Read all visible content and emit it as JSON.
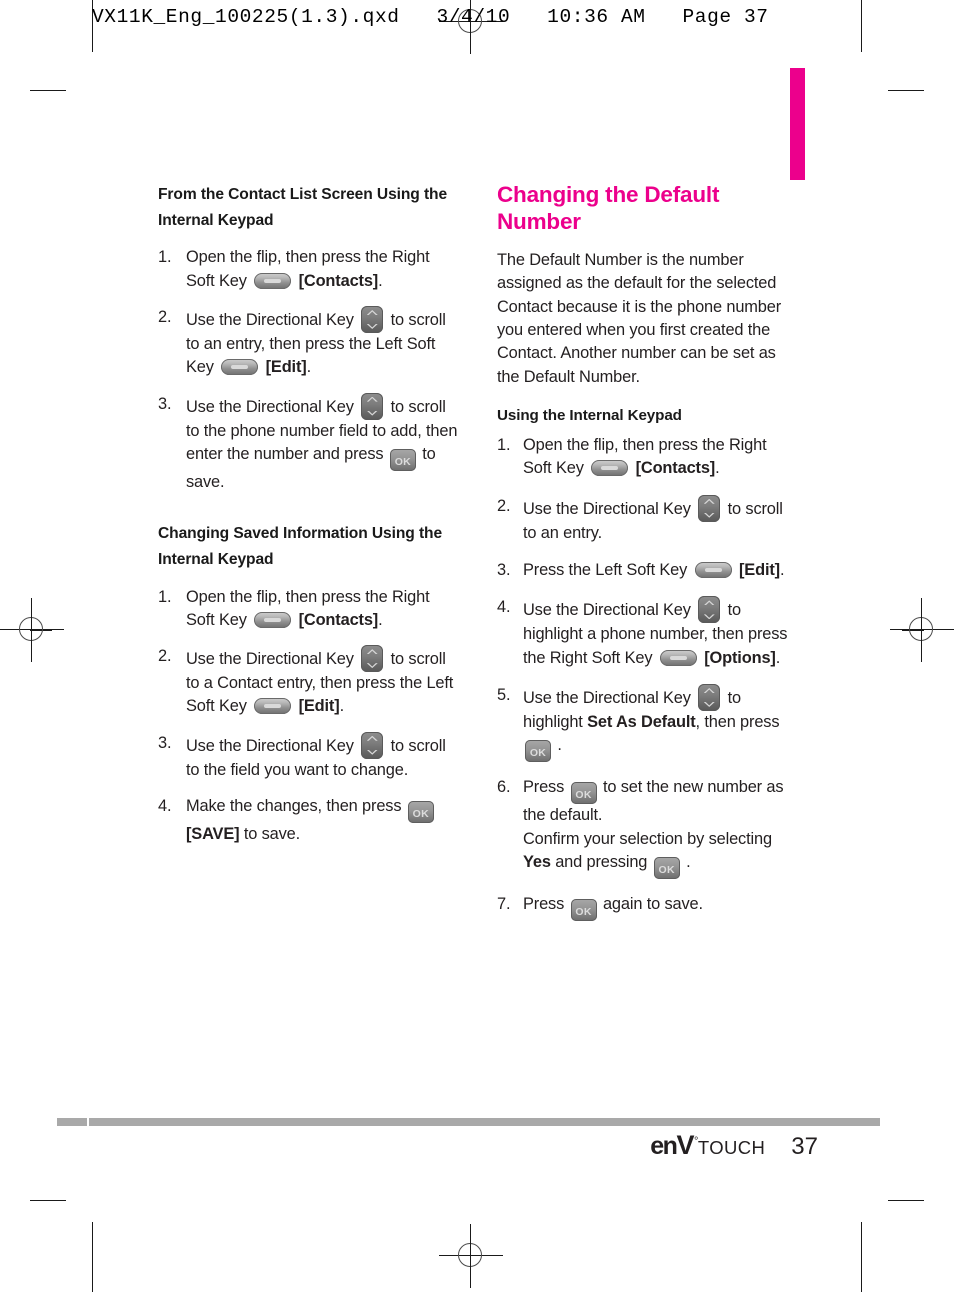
{
  "page": {
    "slug": "VX11K_Eng_100225(1.3).qxd   3/4/10   10:36 AM   Page 37",
    "accent_color": "#ec008c",
    "text_color": "#231f20"
  },
  "footer": {
    "brand_en": "en",
    "brand_v": "V",
    "brand_star": "°",
    "brand_touch": "TOUCH",
    "page_number": "37"
  },
  "icons": {
    "soft_key": "soft-key-icon",
    "directional_key": "directional-key-icon",
    "ok_key": "ok-key-icon",
    "ok_label": "OK"
  },
  "left_column": {
    "section1": {
      "title": "From the Contact List Screen Using the Internal Keypad",
      "steps": [
        {
          "num": "1.",
          "parts": [
            {
              "t": "text",
              "v": "Open the flip, then press the Right Soft Key "
            },
            {
              "t": "key",
              "v": "soft"
            },
            {
              "t": "bold",
              "v": " [Contacts]"
            },
            {
              "t": "text",
              "v": "."
            }
          ]
        },
        {
          "num": "2.",
          "parts": [
            {
              "t": "text",
              "v": "Use the Directional Key "
            },
            {
              "t": "key",
              "v": "dir"
            },
            {
              "t": "text",
              "v": " to scroll to an entry, then press the Left Soft Key "
            },
            {
              "t": "key",
              "v": "soft"
            },
            {
              "t": "bold",
              "v": " [Edit]"
            },
            {
              "t": "text",
              "v": "."
            }
          ]
        },
        {
          "num": "3.",
          "parts": [
            {
              "t": "text",
              "v": "Use the Directional Key "
            },
            {
              "t": "key",
              "v": "dir"
            },
            {
              "t": "text",
              "v": " to scroll to the phone number field to add, then enter the number and press "
            },
            {
              "t": "key",
              "v": "ok"
            },
            {
              "t": "text",
              "v": " to save."
            }
          ]
        }
      ]
    },
    "section2": {
      "title": "Changing Saved Information Using the Internal Keypad",
      "steps": [
        {
          "num": "1.",
          "parts": [
            {
              "t": "text",
              "v": "Open the flip, then press the Right Soft Key "
            },
            {
              "t": "key",
              "v": "soft"
            },
            {
              "t": "bold",
              "v": " [Contacts]"
            },
            {
              "t": "text",
              "v": "."
            }
          ]
        },
        {
          "num": "2.",
          "parts": [
            {
              "t": "text",
              "v": "Use the Directional Key "
            },
            {
              "t": "key",
              "v": "dir"
            },
            {
              "t": "text",
              "v": " to scroll to a Contact entry, then press the Left Soft Key "
            },
            {
              "t": "key",
              "v": "soft"
            },
            {
              "t": "bold",
              "v": " [Edit]"
            },
            {
              "t": "text",
              "v": "."
            }
          ]
        },
        {
          "num": "3.",
          "parts": [
            {
              "t": "text",
              "v": "Use the Directional Key "
            },
            {
              "t": "key",
              "v": "dir"
            },
            {
              "t": "text",
              "v": " to scroll to the field you want to change."
            }
          ]
        },
        {
          "num": "4.",
          "parts": [
            {
              "t": "text",
              "v": "Make the changes, then press "
            },
            {
              "t": "key",
              "v": "ok"
            },
            {
              "t": "bold",
              "v": " [SAVE]"
            },
            {
              "t": "text",
              "v": " to save."
            }
          ]
        }
      ]
    }
  },
  "right_column": {
    "chapter_title": "Changing the Default Number",
    "intro": "The Default Number is the number assigned as the default for the selected Contact because it is the phone number you entered when you first created the Contact. Another number can be set as the Default Number.",
    "section": {
      "title": "Using the Internal Keypad",
      "steps": [
        {
          "num": "1.",
          "parts": [
            {
              "t": "text",
              "v": "Open the flip, then press the Right Soft Key "
            },
            {
              "t": "key",
              "v": "soft"
            },
            {
              "t": "bold",
              "v": " [Contacts]"
            },
            {
              "t": "text",
              "v": "."
            }
          ]
        },
        {
          "num": "2.",
          "parts": [
            {
              "t": "text",
              "v": "Use the Directional Key "
            },
            {
              "t": "key",
              "v": "dir"
            },
            {
              "t": "text",
              "v": " to scroll to an entry."
            }
          ]
        },
        {
          "num": "3.",
          "parts": [
            {
              "t": "text",
              "v": "Press the Left Soft Key "
            },
            {
              "t": "key",
              "v": "soft"
            },
            {
              "t": "bold",
              "v": " [Edit]"
            },
            {
              "t": "text",
              "v": "."
            }
          ]
        },
        {
          "num": "4.",
          "parts": [
            {
              "t": "text",
              "v": "Use the Directional Key "
            },
            {
              "t": "key",
              "v": "dir"
            },
            {
              "t": "text",
              "v": " to highlight a phone number, then press the Right Soft Key "
            },
            {
              "t": "key",
              "v": "soft"
            },
            {
              "t": "bold",
              "v": " [Options]"
            },
            {
              "t": "text",
              "v": "."
            }
          ]
        },
        {
          "num": "5.",
          "parts": [
            {
              "t": "text",
              "v": "Use the Directional Key "
            },
            {
              "t": "key",
              "v": "dir"
            },
            {
              "t": "text",
              "v": " to highlight "
            },
            {
              "t": "bold",
              "v": "Set As Default"
            },
            {
              "t": "text",
              "v": ", then press "
            },
            {
              "t": "key",
              "v": "ok"
            },
            {
              "t": "text",
              "v": " ."
            }
          ]
        },
        {
          "num": "6.",
          "parts": [
            {
              "t": "text",
              "v": "Press "
            },
            {
              "t": "key",
              "v": "ok"
            },
            {
              "t": "text",
              "v": " to set the new number as the default."
            },
            {
              "t": "break",
              "v": ""
            },
            {
              "t": "text",
              "v": "Confirm your selection by selecting "
            },
            {
              "t": "bold",
              "v": "Yes"
            },
            {
              "t": "text",
              "v": " and pressing "
            },
            {
              "t": "key",
              "v": "ok"
            },
            {
              "t": "text",
              "v": " ."
            }
          ]
        },
        {
          "num": "7.",
          "parts": [
            {
              "t": "text",
              "v": "Press "
            },
            {
              "t": "key",
              "v": "ok"
            },
            {
              "t": "text",
              "v": " again to save."
            }
          ]
        }
      ]
    }
  }
}
